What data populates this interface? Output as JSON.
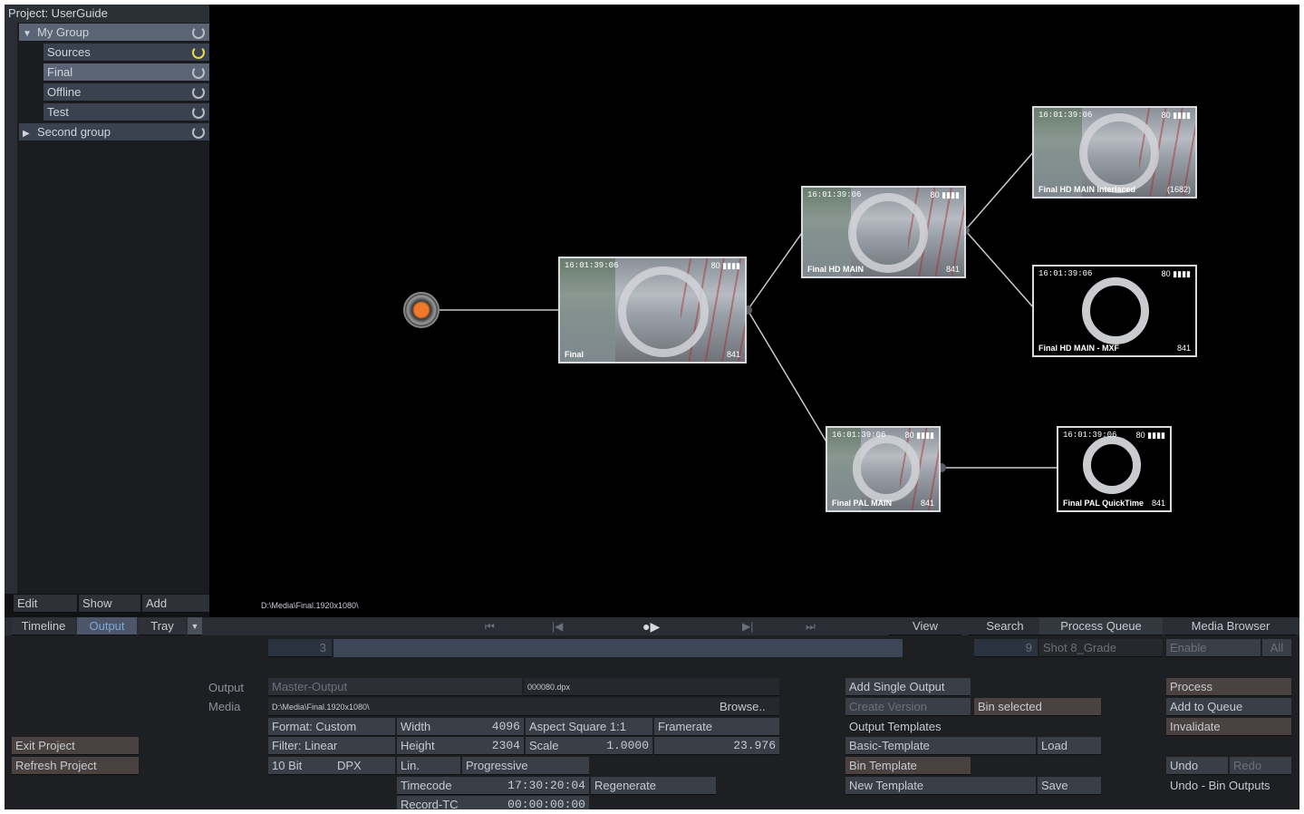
{
  "project": {
    "title": "Project: UserGuide"
  },
  "tree": [
    {
      "label": "My Group",
      "arrow": "▼"
    },
    {
      "label": "Sources"
    },
    {
      "label": "Final"
    },
    {
      "label": "Offline"
    },
    {
      "label": "Test"
    },
    {
      "label": "Second group",
      "arrow": "▶"
    }
  ],
  "sidebar_tabs": {
    "edit": "Edit",
    "show": "Show",
    "add": "Add"
  },
  "bottom_tabs": {
    "timeline": "Timeline",
    "output": "Output",
    "tray": "Tray",
    "tray_arrow": "▼"
  },
  "canvas_path": "D:\\Media\\Final.1920x1080\\",
  "nodes": {
    "final": {
      "tc": "16:01:39:06",
      "meter": "80 ▮▮▮▮",
      "name": "Final",
      "frames": "841"
    },
    "hd_main": {
      "tc": "16:01:39:06",
      "meter": "80 ▮▮▮▮",
      "name": "Final HD MAIN",
      "frames": "841"
    },
    "hd_interlaced": {
      "tc": "16:01:39:06",
      "meter": "80 ▮▮▮▮",
      "name": "Final HD MAIN Interlaced",
      "frames": "(1682)"
    },
    "hd_mxf": {
      "tc": "16:01:39:06",
      "meter": "80 ▮▮▮▮",
      "name": "Final HD MAIN - MXF",
      "frames": "841"
    },
    "pal_main": {
      "tc": "16:01:39:06",
      "meter": "80 ▮▮▮▮",
      "name": "Final PAL MAIN",
      "frames": "841"
    },
    "pal_quicktime": {
      "tc": "16:01:39:06",
      "meter": "80 ▮▮▮▮",
      "name": "Final PAL QuickTime",
      "frames": "841"
    }
  },
  "transport": {
    "first": "⏮",
    "prev": "|◀",
    "play": "●▶",
    "next": "▶|",
    "last": "⏭"
  },
  "top_right_tabs": {
    "view": "View",
    "search": "Search",
    "process_queue": "Process Queue",
    "media_browser": "Media Browser"
  },
  "scrub": {
    "left_value": "3",
    "right_value": "9",
    "shot": "Shot 8_Grade",
    "enable": "Enable",
    "all": "All"
  },
  "output": {
    "output_label": "Output",
    "media_label": "Media",
    "output_name": "Master-Output",
    "file_pattern": "000080.dpx",
    "media_path": "D:\\Media\\Final.1920x1080\\",
    "browse": "Browse..",
    "format": "Format: Custom",
    "filter": "Filter: Linear",
    "bit": "10 Bit",
    "type": "DPX",
    "width_label": "Width",
    "width": "4096",
    "height_label": "Height",
    "height": "2304",
    "lin": "Lin.",
    "progressive": "Progressive",
    "aspect": "Aspect Square 1:1",
    "scale_label": "Scale",
    "scale": "1.0000",
    "framerate_label": "Framerate",
    "framerate": "23.976",
    "timecode_label": "Timecode",
    "timecode": "17:30:20:04",
    "regenerate": "Regenerate",
    "record_tc_label": "Record-TC",
    "record_tc": "00:00:00:00"
  },
  "project_buttons": {
    "exit": "Exit Project",
    "refresh": "Refresh Project"
  },
  "templates": {
    "add_single": "Add Single Output",
    "create_version": "Create Version",
    "bin_selected": "Bin selected",
    "output_templates": "Output Templates",
    "basic_template": "Basic-Template",
    "load": "Load",
    "bin_template": "Bin Template",
    "new_template": "New Template",
    "save": "Save"
  },
  "process": {
    "process": "Process",
    "add_to_queue": "Add to Queue",
    "invalidate": "Invalidate",
    "undo": "Undo",
    "redo": "Redo",
    "undo_status": "Undo - Bin Outputs"
  },
  "colors": {
    "accent": "#7ea6d8",
    "panel": "#3a3f47",
    "canvas": "#000000",
    "highlight_refresh": "#e8d84a"
  }
}
